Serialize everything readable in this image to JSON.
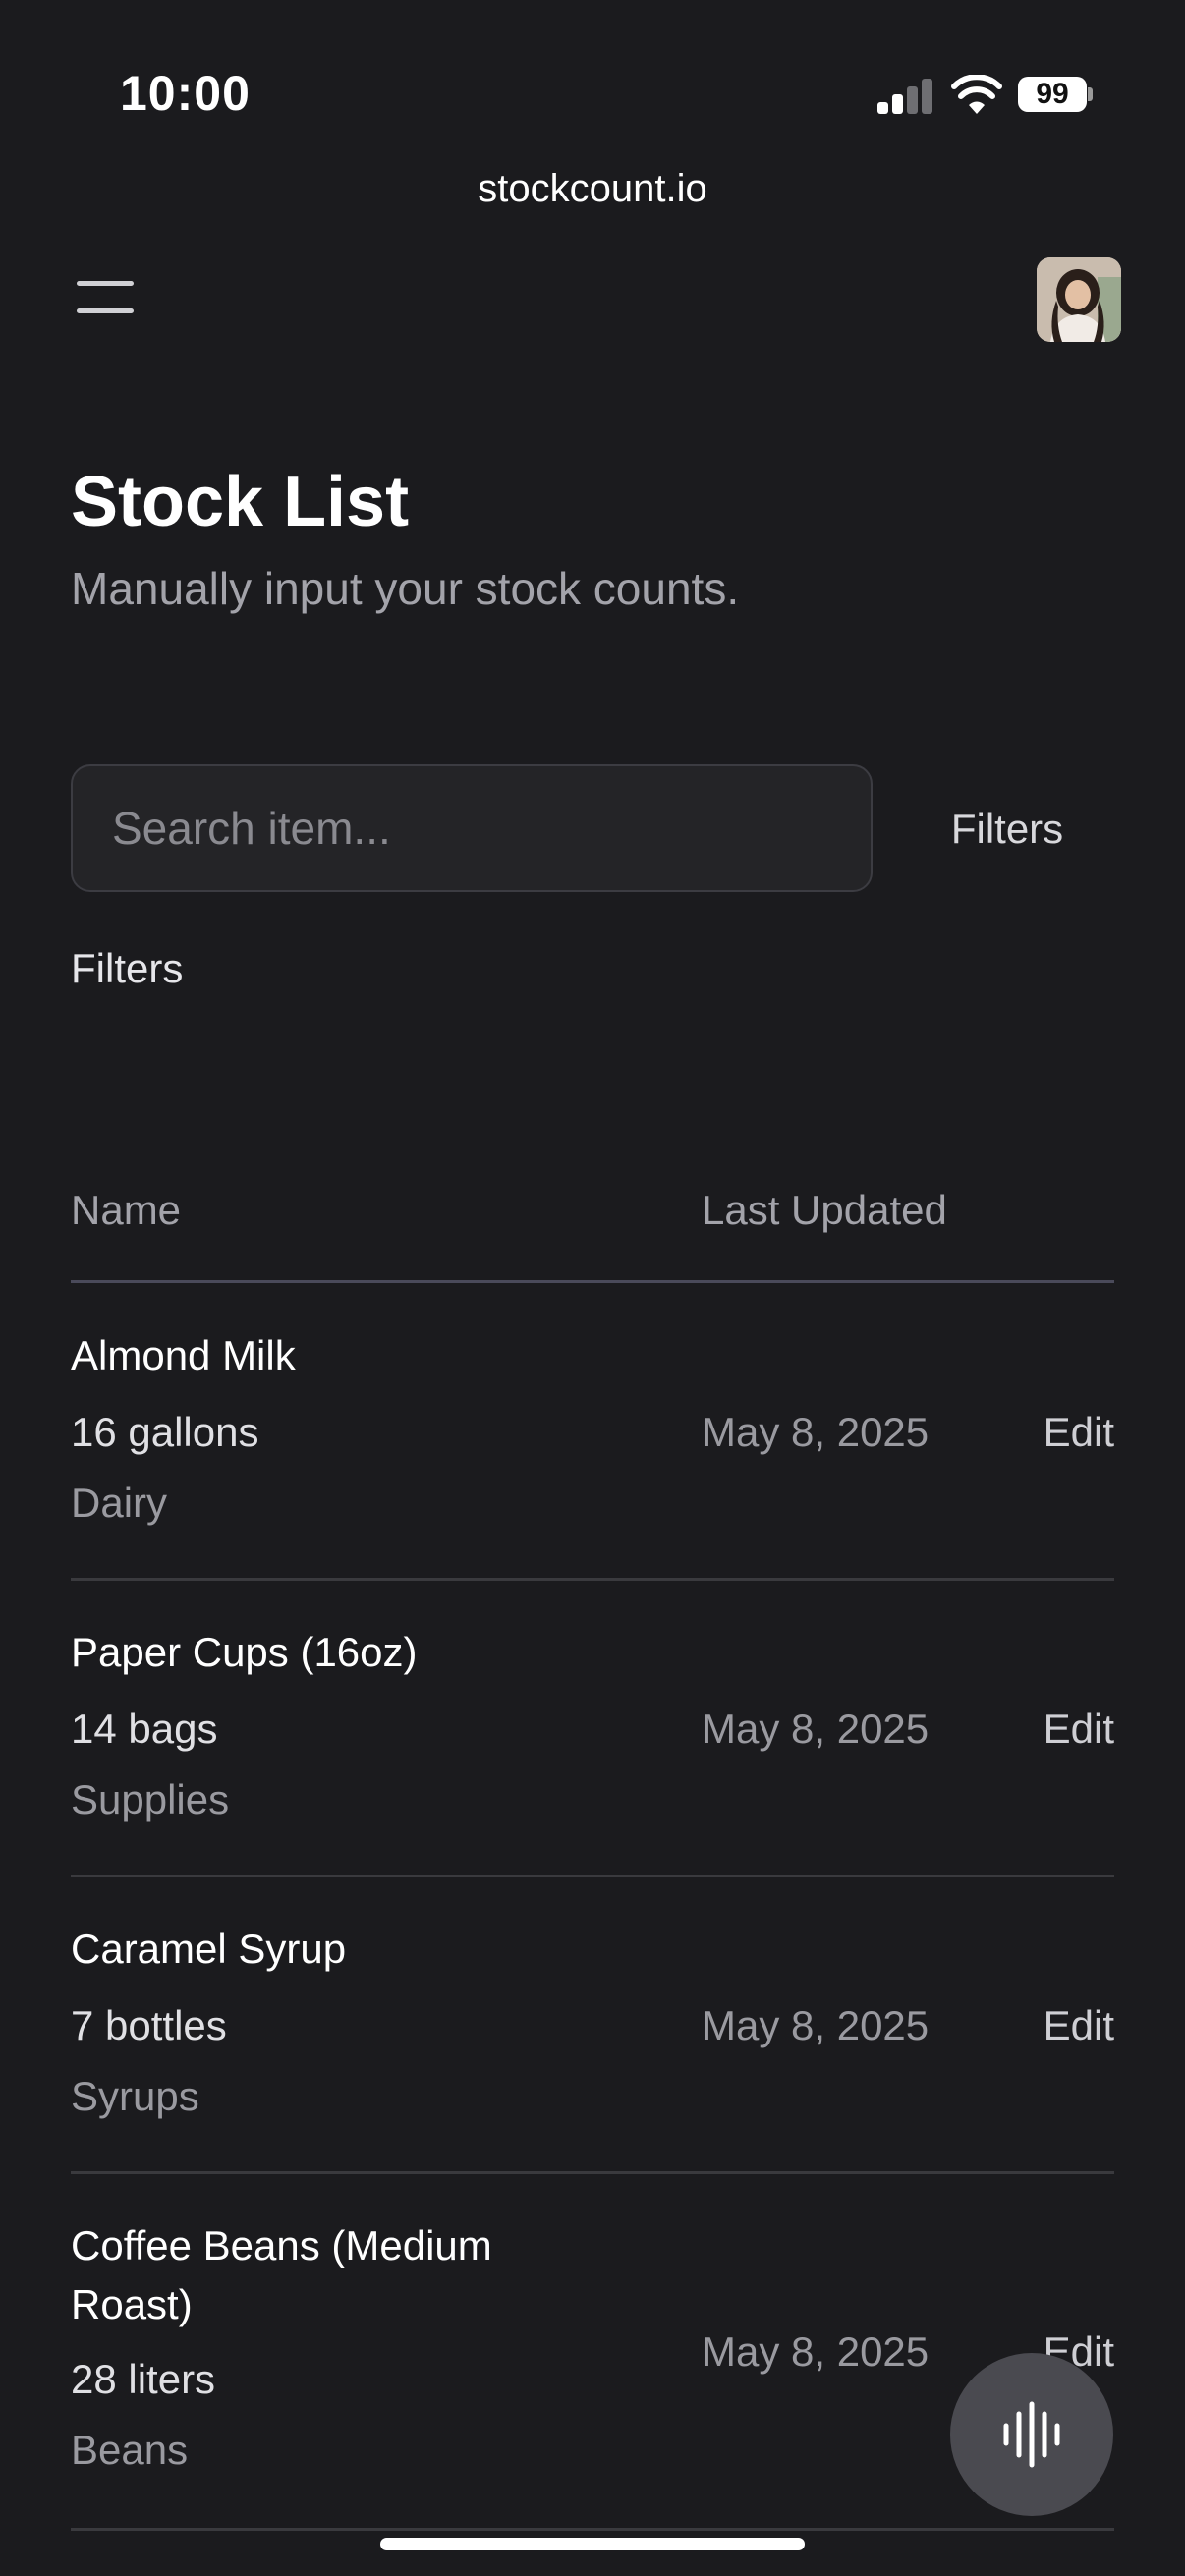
{
  "status_bar": {
    "time": "10:00",
    "battery": "99"
  },
  "browser": {
    "url": "stockcount.io"
  },
  "header": {
    "menu_icon": "hamburger-icon",
    "avatar_icon": "user-avatar"
  },
  "page": {
    "title": "Stock List",
    "subtitle": "Manually input your stock counts."
  },
  "search": {
    "placeholder": "Search item...",
    "value": ""
  },
  "filters_button": "Filters",
  "filters_label": "Filters",
  "table": {
    "columns": {
      "name": "Name",
      "last_updated": "Last Updated"
    },
    "rows": [
      {
        "name": "Almond Milk",
        "quantity": "16 gallons",
        "category": "Dairy",
        "last_updated": "May 8, 2025",
        "action": "Edit"
      },
      {
        "name": "Paper Cups (16oz)",
        "quantity": "14 bags",
        "category": "Supplies",
        "last_updated": "May 8, 2025",
        "action": "Edit"
      },
      {
        "name": "Caramel Syrup",
        "quantity": "7 bottles",
        "category": "Syrups",
        "last_updated": "May 8, 2025",
        "action": "Edit"
      },
      {
        "name": "Coffee Beans (Medium Roast)",
        "quantity": "28 liters",
        "category": "Beans",
        "last_updated": "May 8, 2025",
        "action": "Edit"
      }
    ]
  },
  "fab": {
    "icon": "voice-waveform-icon"
  },
  "colors": {
    "background": "#1b1b1e",
    "text": "#ffffff",
    "muted": "#9a9aa0",
    "fab": "#4a4a50"
  }
}
